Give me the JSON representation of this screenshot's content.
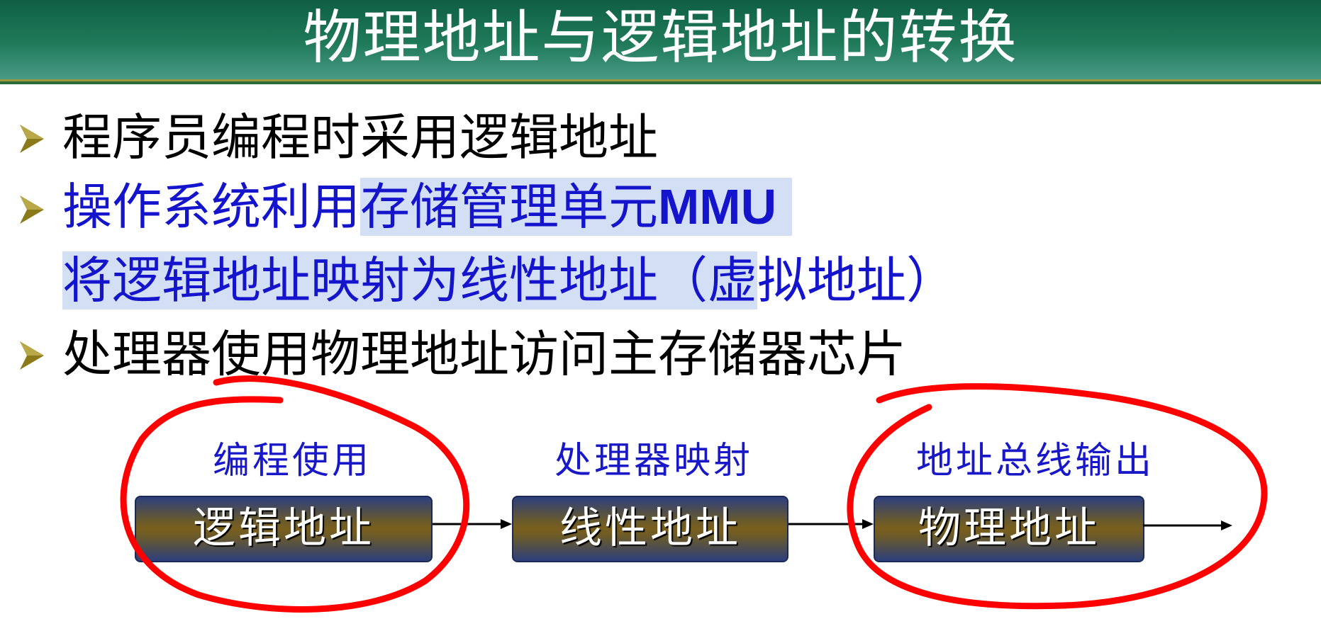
{
  "title": "物理地址与逻辑地址的转换",
  "bullets": {
    "b1": "程序员编程时采用逻辑地址",
    "b2_plain": "操作系统利用",
    "b2_hl_cn": "存储管理单元",
    "b2_hl_latin": "MMU",
    "b2_line2_hl": "将逻辑地址映射为线性地址（虚",
    "b2_line2_plain": "拟地址）",
    "b3": "处理器使用物理地址访问主存储器芯片"
  },
  "diagram": {
    "stages": [
      {
        "label": "编程使用",
        "box": "逻辑地址"
      },
      {
        "label": "处理器映射",
        "box": "线性地址"
      },
      {
        "label": "地址总线输出",
        "box": "物理地址"
      }
    ]
  },
  "colors": {
    "title_bg": "#1f7a5a",
    "bullet_blue": "#1414cc",
    "highlight": "#d3dff5",
    "annotation_red": "#ff0000",
    "bullet_arrow": "#8a7a1a"
  },
  "icons": {
    "bullet": "triangle-bullet-icon",
    "connector": "right-arrow-icon"
  }
}
